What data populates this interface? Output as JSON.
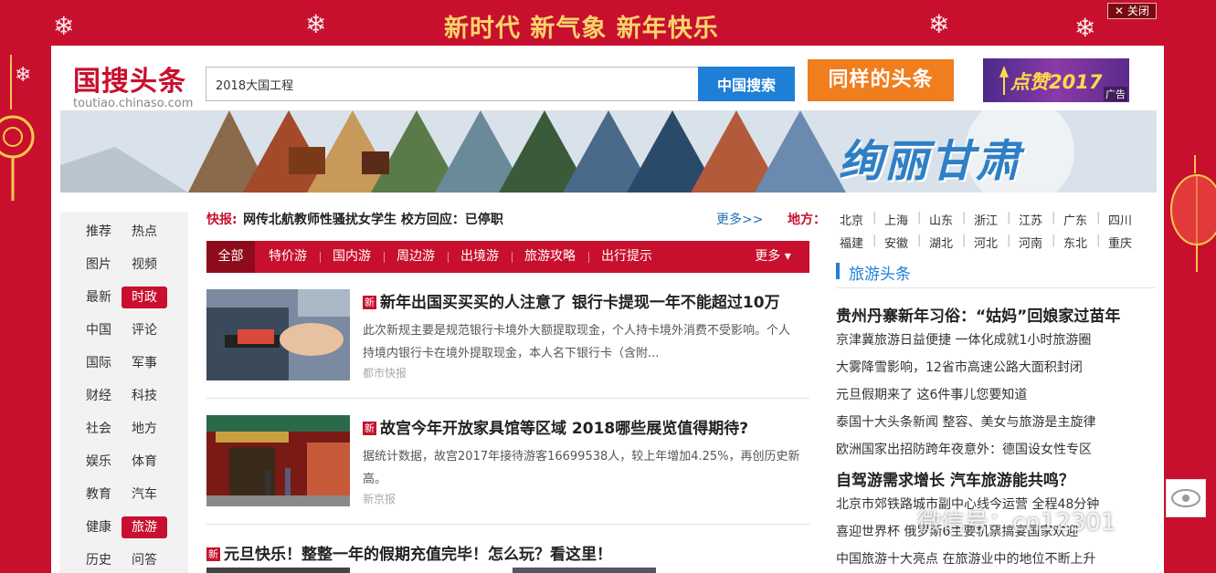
{
  "banner": {
    "slogan": "新时代 新气象  新年快乐",
    "close_label": "关闭"
  },
  "header": {
    "logo_name": "国搜头条",
    "logo_url": "toutiao.chinaso.com",
    "search_value": "2018大国工程",
    "search_button": "中国搜索",
    "same_button": "同样的头条",
    "ad_text": "点赞2017",
    "ad_tag": "广告"
  },
  "scenic_banner": {
    "title": "绚丽甘肃"
  },
  "left_nav": [
    [
      "推荐",
      "热点"
    ],
    [
      "图片",
      "视频"
    ],
    [
      "最新",
      "时政"
    ],
    [
      "中国",
      "评论"
    ],
    [
      "国际",
      "军事"
    ],
    [
      "财经",
      "科技"
    ],
    [
      "社会",
      "地方"
    ],
    [
      "娱乐",
      "体育"
    ],
    [
      "教育",
      "汽车"
    ],
    [
      "健康",
      "旅游"
    ],
    [
      "历史",
      "问答"
    ]
  ],
  "left_nav_active": [
    "时政",
    "旅游"
  ],
  "ticker": {
    "label": "快报:",
    "text": "网传北航教师性骚扰女学生  校方回应：已停职",
    "more": "更多>>"
  },
  "tabs": [
    "全部",
    "特价游",
    "国内游",
    "周边游",
    "出境游",
    "旅游攻略",
    "出行提示",
    "更多 ▾"
  ],
  "articles": [
    {
      "badge": "新",
      "title": "新年出国买买买的人注意了  银行卡提现一年不能超过10万",
      "summary": "此次新规主要是规范银行卡境外大额提取现金，个人持卡境外消费不受影响。个人持境内银行卡在境外提取现金，本人名下银行卡（含附...",
      "source": "都市快报"
    },
    {
      "badge": "新",
      "title": "故宫今年开放家具馆等区域  2018哪些展览值得期待?",
      "summary": "据统计数据，故宫2017年接待游客16699538人，较上年增加4.25%，再创历史新高。",
      "source": "新京报"
    },
    {
      "badge": "新",
      "title": "元旦快乐！整整一年的假期充值完毕！怎么玩？看这里！"
    }
  ],
  "region": {
    "label": "地方：",
    "cities_row1": [
      "北京",
      "上海",
      "山东",
      "浙江",
      "江苏",
      "广东",
      "四川"
    ],
    "cities_row2": [
      "福建",
      "安徽",
      "湖北",
      "河北",
      "河南",
      "东北",
      "重庆"
    ]
  },
  "right_section": {
    "heading": "旅游头条",
    "items": [
      {
        "text": "贵州丹寨新年习俗：“姑妈”回娘家过苗年",
        "bold": true
      },
      {
        "text": "京津冀旅游日益便捷  一体化成就1小时旅游圈",
        "bold": false
      },
      {
        "text": "大雾降雪影响，12省市高速公路大面积封闭",
        "bold": false
      },
      {
        "text": "元旦假期来了  这6件事儿您要知道",
        "bold": false
      },
      {
        "text": "泰国十大头条新闻  整容、美女与旅游是主旋律",
        "bold": false
      },
      {
        "text": "欧洲国家出招防跨年夜意外：德国设女性专区",
        "bold": false
      },
      {
        "text": "自驾游需求增长  汽车旅游能共鸣？",
        "bold": true
      },
      {
        "text": "北京市郊铁路城市副中心线今运营  全程48分钟",
        "bold": false
      },
      {
        "text": "喜迎世界杯  俄罗斯6主要机票搞宴国家欢迎",
        "bold": false
      },
      {
        "text": "中国旅游十大亮点  在旅游业中的地位不断上升",
        "bold": false
      }
    ]
  },
  "watermark": "微信号：cn12301",
  "colors": {
    "brand_red": "#c8102e",
    "link_blue": "#1f7fd6",
    "orange": "#f07d1e"
  }
}
